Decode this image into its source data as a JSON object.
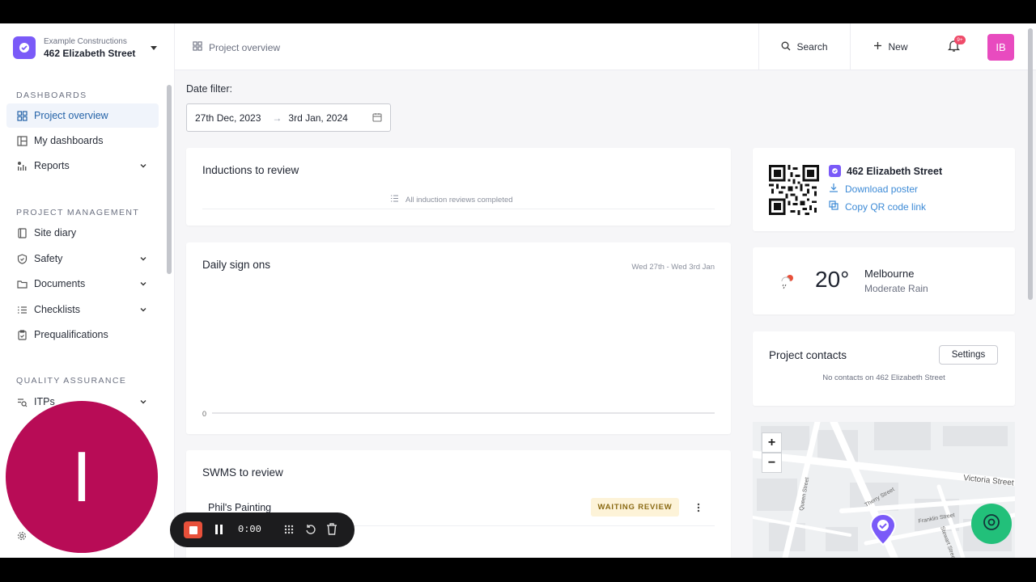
{
  "org": {
    "company": "Example Constructions",
    "site": "462 Elizabeth Street"
  },
  "sidebar": {
    "sections": [
      {
        "title": "DASHBOARDS",
        "items": [
          {
            "label": "Project overview",
            "icon": "grid-icon",
            "active": true
          },
          {
            "label": "My dashboards",
            "icon": "dashboard-icon"
          },
          {
            "label": "Reports",
            "icon": "reports-icon",
            "expandable": true
          }
        ]
      },
      {
        "title": "PROJECT MANAGEMENT",
        "items": [
          {
            "label": "Site diary",
            "icon": "book-icon"
          },
          {
            "label": "Safety",
            "icon": "shield-icon",
            "expandable": true
          },
          {
            "label": "Documents",
            "icon": "folder-icon",
            "expandable": true
          },
          {
            "label": "Checklists",
            "icon": "checklist-icon",
            "expandable": true
          },
          {
            "label": "Prequalifications",
            "icon": "clipboard-icon"
          }
        ]
      },
      {
        "title": "QUALITY ASSURANCE",
        "items": [
          {
            "label": "ITPs",
            "icon": "itp-icon",
            "expandable": true
          }
        ]
      }
    ]
  },
  "topbar": {
    "breadcrumb": "Project overview",
    "search_label": "Search",
    "new_label": "New",
    "notification_badge": "9+",
    "user_initials": "IB"
  },
  "date_filter": {
    "label": "Date filter:",
    "start": "27th Dec, 2023",
    "end": "3rd Jan, 2024",
    "arrow": "→"
  },
  "inductions": {
    "title": "Inductions to review",
    "empty_text": "All induction reviews completed"
  },
  "sign_ons": {
    "title": "Daily sign ons",
    "range": "Wed 27th - Wed 3rd Jan",
    "y_zero": "0"
  },
  "chart_data": {
    "type": "line",
    "title": "Daily sign ons",
    "subtitle": "Wed 27th - Wed 3rd Jan",
    "y_tick_labels": [
      "0"
    ],
    "series": []
  },
  "swms": {
    "title": "SWMS to review",
    "rows": [
      {
        "name": "Phil's Painting",
        "status": "WAITING REVIEW"
      }
    ]
  },
  "qr_card": {
    "site": "462 Elizabeth Street",
    "download": "Download poster",
    "copy": "Copy QR code link"
  },
  "weather": {
    "temp": "20°",
    "city": "Melbourne",
    "condition": "Moderate Rain"
  },
  "contacts": {
    "title": "Project contacts",
    "settings_label": "Settings",
    "empty_text": "No contacts on 462 Elizabeth Street"
  },
  "map": {
    "streets": [
      "Victoria Street",
      "Queen Street",
      "Therry Street",
      "Franklin Street",
      "Stewart Street"
    ],
    "zoom_in": "+",
    "zoom_out": "−"
  },
  "overlay": {
    "camera_initial": "I",
    "timer": "0:00"
  },
  "colors": {
    "accent": "#2563a8",
    "brand": "#7a5af8",
    "avatar": "#e84bbf",
    "help": "#22c07a",
    "recording": "#e8503a",
    "camera": "#b80c56"
  }
}
